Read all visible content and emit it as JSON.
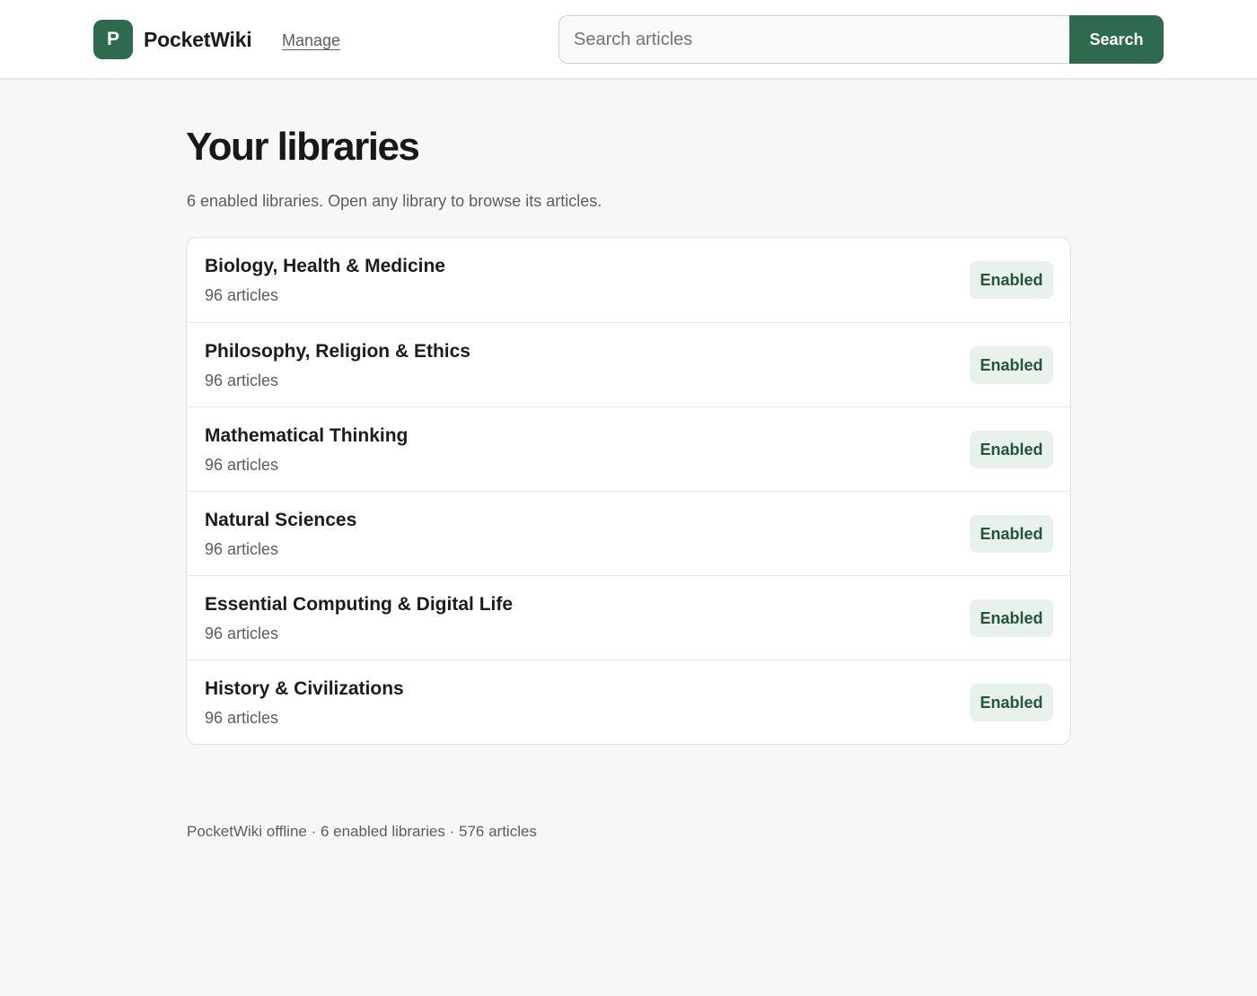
{
  "header": {
    "logo_letter": "P",
    "brand": "PocketWiki",
    "nav_manage": "Manage",
    "search_placeholder": "Search articles",
    "search_value": "",
    "search_button": "Search"
  },
  "main": {
    "title": "Your libraries",
    "subtitle": "6 enabled libraries. Open any library to browse its articles.",
    "libraries": [
      {
        "name": "Biology, Health & Medicine",
        "count": "96 articles",
        "status": "Enabled"
      },
      {
        "name": "Philosophy, Religion & Ethics",
        "count": "96 articles",
        "status": "Enabled"
      },
      {
        "name": "Mathematical Thinking",
        "count": "96 articles",
        "status": "Enabled"
      },
      {
        "name": "Natural Sciences",
        "count": "96 articles",
        "status": "Enabled"
      },
      {
        "name": "Essential Computing & Digital Life",
        "count": "96 articles",
        "status": "Enabled"
      },
      {
        "name": "History & Civilizations",
        "count": "96 articles",
        "status": "Enabled"
      }
    ]
  },
  "footer": {
    "text": "PocketWiki offline · 6 enabled libraries · 576 articles"
  },
  "colors": {
    "brand": "#2e6a4d",
    "badge_bg": "#e8f1eb",
    "badge_text": "#24553d",
    "page_bg": "#f7f7f7"
  }
}
